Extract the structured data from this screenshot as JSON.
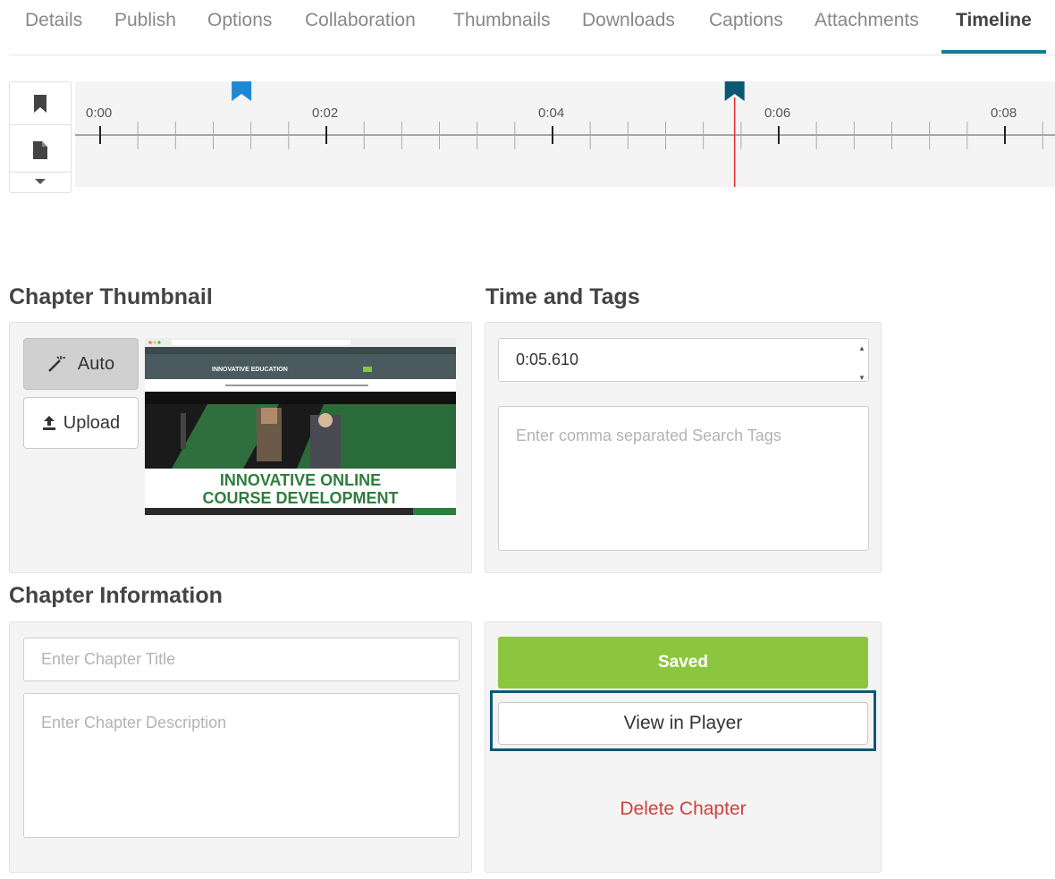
{
  "tabs": [
    {
      "label": "Details"
    },
    {
      "label": "Publish"
    },
    {
      "label": "Options"
    },
    {
      "label": "Collaboration"
    },
    {
      "label": "Thumbnails"
    },
    {
      "label": "Downloads"
    },
    {
      "label": "Captions"
    },
    {
      "label": "Attachments"
    },
    {
      "label": "Timeline",
      "active": true
    }
  ],
  "timeline": {
    "tick_labels": [
      "0:00",
      "0:02",
      "0:04",
      "0:06",
      "0:08"
    ],
    "playhead_seconds": 5.61,
    "chapter_markers_seconds": [
      1.25,
      5.61
    ],
    "tools": {
      "chapter_icon": "bookmark-icon",
      "slide_icon": "document-icon",
      "more_icon": "chevron-down-icon"
    },
    "colors": {
      "marker_light": "#1e88d4",
      "marker_dark": "#0b5875",
      "playhead": "#e0302c"
    }
  },
  "chapter_thumbnail": {
    "title": "Chapter Thumbnail",
    "auto_label": "Auto",
    "upload_label": "Upload",
    "preview": {
      "site_name": "INNOVATIVE EDUCATION",
      "headline_line1": "INNOVATIVE ONLINE",
      "headline_line2": "COURSE DEVELOPMENT"
    }
  },
  "time_and_tags": {
    "title": "Time and Tags",
    "time_value": "0:05.610",
    "tags_placeholder": "Enter comma separated Search Tags"
  },
  "chapter_information": {
    "title": "Chapter Information",
    "title_placeholder": "Enter Chapter Title",
    "description_placeholder": "Enter Chapter Description"
  },
  "actions": {
    "saved_label": "Saved",
    "view_label": "View in Player",
    "delete_label": "Delete Chapter",
    "colors": {
      "saved": "#8cc63f",
      "delete": "#d0403b",
      "focus": "#0b5875"
    }
  }
}
